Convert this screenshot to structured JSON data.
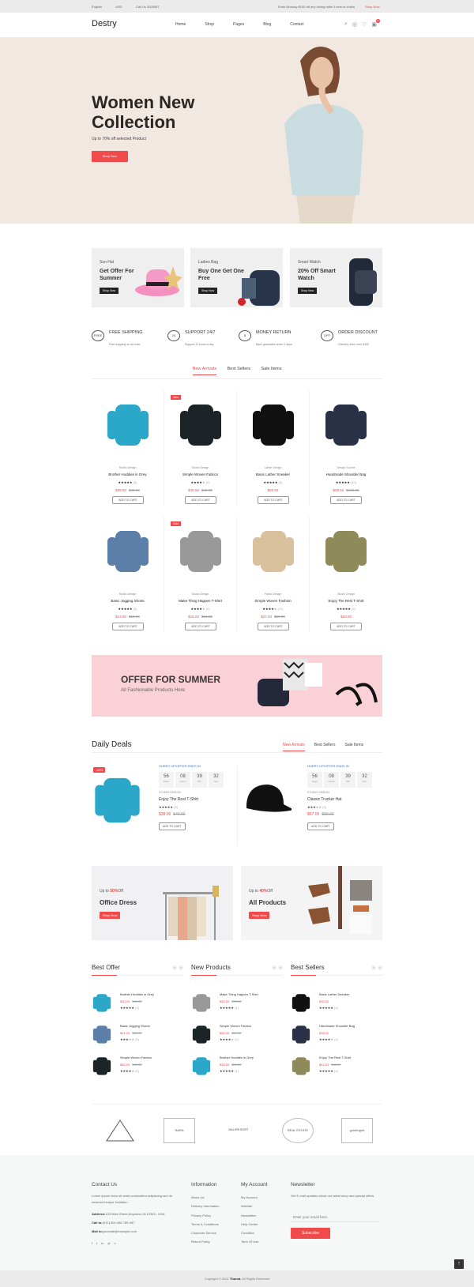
{
  "topbar": {
    "language": "English",
    "currency": "USD",
    "phone": "Call Us 3925687",
    "promo": "Ends Monday $100 off any dining table 5 sets of chairs",
    "promo_link": "Shop Now"
  },
  "header": {
    "logo": "Destry",
    "nav": [
      "Home",
      "Shop",
      "Pages",
      "Blog",
      "Contact"
    ],
    "cart_count": "0"
  },
  "hero": {
    "title": "Women New Collection",
    "subtitle": "Up to 70% off selected Product",
    "button": "Shop Now"
  },
  "banners": [
    {
      "sub": "Sun Hat",
      "title": "Get Offer For Summer",
      "button": "Shop Now"
    },
    {
      "sub": "Ladies Bag",
      "title": "Buy One Get One Free",
      "button": "Shop Now"
    },
    {
      "sub": "Smart Watch",
      "title": "20% Off Smart Watch",
      "button": "Shop Now"
    }
  ],
  "features": [
    {
      "icon": "truck-icon",
      "glyph": "FREE",
      "title": "FREE SHIPPING",
      "text": "Free shipping on all order"
    },
    {
      "icon": "support-icon",
      "glyph": "24",
      "title": "SUPPORT 24/7",
      "text": "Support 24 hours a day"
    },
    {
      "icon": "money-icon",
      "glyph": "$",
      "title": "MONEY RETURN",
      "text": "Back guarantee under 5 days"
    },
    {
      "icon": "discount-icon",
      "glyph": "OFF",
      "title": "ORDER DISCOUNT",
      "text": "Onevery order over $150"
    }
  ],
  "tabs": [
    "New Arrivals",
    "Best Sellers",
    "Sale Items"
  ],
  "add_to_cart": "ADD TO CART",
  "products": [
    {
      "brand": "Studio Design",
      "name": "Brother Hoddies in Grey",
      "rating": 5,
      "reviews": "(3)",
      "price": "$38.50",
      "old": "$40.00",
      "tag": "",
      "color": "#2aa7c9"
    },
    {
      "brand": "Studio Design",
      "name": "Simple Woven Fabrics",
      "rating": 3.5,
      "reviews": "(2)",
      "price": "$45.50",
      "old": "$49.00",
      "tag": "New",
      "color": "#1c2428"
    },
    {
      "brand": "Lather Design",
      "name": "Basic Lather Sneaker",
      "rating": 5,
      "reviews": "(3)",
      "price": "$65.50",
      "old": "",
      "tag": "",
      "color": "#111"
    },
    {
      "brand": "Design Source",
      "name": "Handmade Shoulder Bag",
      "rating": 5,
      "reviews": "(10)",
      "price": "$58.50",
      "old": "$100.00",
      "tag": "",
      "color": "#2a3146"
    },
    {
      "brand": "Studio Design",
      "name": "Basic Jogging Shorts",
      "rating": 5,
      "reviews": "(3)",
      "price": "$14.50",
      "old": "$18.00",
      "tag": "",
      "color": "#5b7fa8"
    },
    {
      "brand": "Studio Design",
      "name": "Make Thing Happen T-Shirt",
      "rating": 4,
      "reviews": "(2)",
      "price": "$15.00",
      "old": "$18.00",
      "tag": "Sold",
      "color": "#999"
    },
    {
      "brand": "Fabric Design",
      "name": "Simple Woven Fashion",
      "rating": 3.5,
      "reviews": "(10)",
      "price": "$27.00",
      "old": "$29.00",
      "tag": "",
      "color": "#d8c19c"
    },
    {
      "brand": "Studio Design",
      "name": "Enjoy The Rest T-Shirt",
      "rating": 5,
      "reviews": "(4)",
      "price": "$20.00",
      "old": "",
      "tag": "",
      "color": "#8f8a5a"
    }
  ],
  "summer": {
    "title": "OFFER FOR SUMMER",
    "subtitle": "All Fashionable Products Here"
  },
  "daily_deals": {
    "title": "Daily Deals",
    "tabs": [
      "New Arrivals",
      "Best Sellers",
      "Sale Items"
    ],
    "hurry": "HURRY UP!OFFER ENDS IN",
    "countdown": [
      {
        "v": "56",
        "l": "Days"
      },
      {
        "v": "08",
        "l": "Hours"
      },
      {
        "v": "39",
        "l": "Min"
      },
      {
        "v": "32",
        "l": "Sec"
      }
    ],
    "items": [
      {
        "badge": "-10%",
        "brand": "STUDIO DESIGN",
        "name": "Enjoy The Rest T-Shirt",
        "rating": 5,
        "reviews": "(3)",
        "price": "$38.00",
        "old": "$40.00"
      },
      {
        "badge": "",
        "brand": "STUDIO DESIGN",
        "name": "Classic Trucker Hat",
        "rating": 3,
        "reviews": "(3)",
        "price": "$67.00",
        "old": "$80.00"
      }
    ]
  },
  "promos": [
    {
      "prefix": "Up to",
      "percent": "50%",
      "suffix": "Off",
      "title": "Office Dress",
      "button": "Shop Now"
    },
    {
      "prefix": "Up to",
      "percent": "40%",
      "suffix": "Off",
      "title": "All Products",
      "button": "Shop Now"
    }
  ],
  "lists": [
    {
      "title": "Best Offer",
      "items": [
        {
          "name": "Brother Hoddies in Grey",
          "price": "$30.00",
          "old": "$40.00",
          "rating": 5,
          "reviews": "(3)",
          "color": "#2aa7c9"
        },
        {
          "name": "Basic Jogging Shorts",
          "price": "$21.00",
          "old": "$25.00",
          "rating": 3,
          "reviews": "(3)",
          "color": "#5b7fa8"
        },
        {
          "name": "Simple Woven Fabrics",
          "price": "$80.00",
          "old": "$90.00",
          "rating": 4,
          "reviews": "(2)",
          "color": "#1c2428"
        }
      ]
    },
    {
      "title": "New Products",
      "items": [
        {
          "name": "Make Thing Happen T-Shirt",
          "price": "$65.50",
          "old": "$70.00",
          "rating": 5,
          "reviews": "(4)",
          "color": "#999"
        },
        {
          "name": "Simple Woven Fabrics",
          "price": "$55.00",
          "old": "$60.00",
          "rating": 4,
          "reviews": "(2)",
          "color": "#1c2428"
        },
        {
          "name": "Brother Hoddies in Grey",
          "price": "$38.00",
          "old": "$40.00",
          "rating": 5,
          "reviews": "(4)",
          "color": "#2aa7c9"
        }
      ]
    },
    {
      "title": "Best Sellers",
      "items": [
        {
          "name": "Basic Lather Sneaker",
          "price": "$35.00",
          "old": "",
          "rating": 5,
          "reviews": "(4)",
          "color": "#111"
        },
        {
          "name": "Handmade Shoulder Bag",
          "price": "$38.00",
          "old": "",
          "rating": 4,
          "reviews": "(2)",
          "color": "#2a3146"
        },
        {
          "name": "Enjoy The Rest T-Shirt",
          "price": "$44.00",
          "old": "$48.00",
          "rating": 5,
          "reviews": "(4)",
          "color": "#8f8a5a"
        }
      ]
    }
  ],
  "brands": [
    "NARA",
    "BALIRESORT",
    "REAL ESTATE",
    "goldengrid"
  ],
  "footer": {
    "contact": {
      "title": "Contact Us",
      "text": "Lorem ipsum dolor sit amet,consectetur adipiscing sed do eiusmod tempor incididun",
      "address_label": "Address:",
      "address": "123 Main Street,Anytown,CA 12345 - USA",
      "call_label": "Call to:",
      "call": "(012) 800 456 789-987",
      "mail_label": "Mail to:",
      "mail": "yourmail@example.com"
    },
    "social": [
      "f",
      "t",
      "in",
      "yt",
      "v"
    ],
    "information": {
      "title": "Information",
      "links": [
        "About Us",
        "Delivery Information",
        "Privacy Policy",
        "Terms & Conditions",
        "Customer Service",
        "Return Policy"
      ]
    },
    "account": {
      "title": "My Account",
      "links": [
        "My Account",
        "Wishlist",
        "Newsletter",
        "Help Center",
        "Condition",
        "Term Of Use"
      ]
    },
    "newsletter": {
      "title": "Newsletter",
      "text": "Get E-mail updates about our latest shop and special offers.",
      "placeholder": "Enter your email here..",
      "button": "Subscribe"
    },
    "copyright_pre": "Copyright © 2021",
    "copyright_brand": "Thunst.",
    "copyright_post": "All Rights Reserved"
  },
  "colors": {
    "accent": "#f14a4a",
    "hero_bg": "#f1e8e2",
    "summer_bg": "#f9d1d7",
    "footer_bg": "#f6f7f7"
  }
}
